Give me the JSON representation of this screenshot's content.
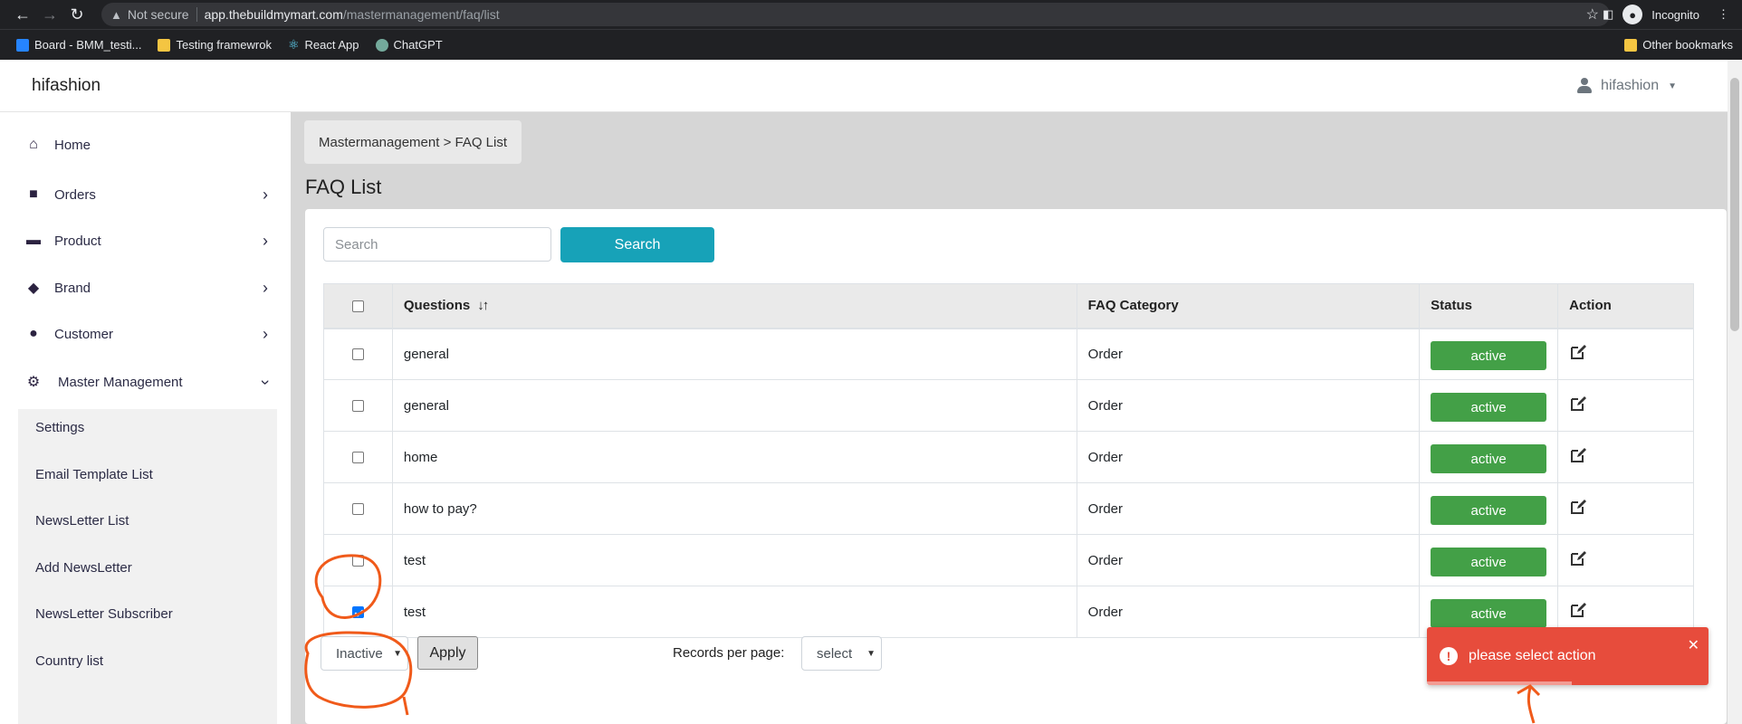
{
  "browser": {
    "security_label": "Not secure",
    "url_host": "app.thebuildmymart.com",
    "url_path": "/mastermanagement/faq/list",
    "profile_label": "Incognito",
    "bookmarks": [
      "Board - BMM_testi...",
      "Testing framewrok",
      "React App",
      "ChatGPT"
    ],
    "other_bookmarks": "Other bookmarks"
  },
  "header": {
    "brand": "hifashion",
    "user": "hifashion"
  },
  "sidebar": {
    "items": [
      {
        "label": "Home",
        "icon": "home-icon"
      },
      {
        "label": "Orders",
        "icon": "bag-icon"
      },
      {
        "label": "Product",
        "icon": "archive-icon"
      },
      {
        "label": "Brand",
        "icon": "tags-icon"
      },
      {
        "label": "Customer",
        "icon": "user-icon"
      },
      {
        "label": "Master Management",
        "icon": "user-gear-icon"
      }
    ],
    "submenu": [
      "Settings",
      "Email Template List",
      "NewsLetter List",
      "Add NewsLetter",
      "NewsLetter Subscriber",
      "Country list"
    ]
  },
  "main": {
    "breadcrumb": "Mastermanagement > FAQ List",
    "title": "FAQ List",
    "search_placeholder": "Search",
    "search_button": "Search",
    "columns": [
      "Questions",
      "FAQ Category",
      "Status",
      "Action"
    ],
    "rows": [
      {
        "question": "general",
        "category": "Order",
        "status": "active",
        "checked": false
      },
      {
        "question": "general",
        "category": "Order",
        "status": "active",
        "checked": false
      },
      {
        "question": "home",
        "category": "Order",
        "status": "active",
        "checked": false
      },
      {
        "question": "how to pay?",
        "category": "Order",
        "status": "active",
        "checked": false
      },
      {
        "question": "test",
        "category": "Order",
        "status": "active",
        "checked": false
      },
      {
        "question": "test",
        "category": "Order",
        "status": "active",
        "checked": true
      }
    ],
    "bulk_action_value": "Inactive",
    "apply_button": "Apply",
    "records_label": "Records per page:",
    "records_value": "select"
  },
  "toast": {
    "message": "please select action"
  },
  "colors": {
    "accent": "#17a2b8",
    "status_active": "#43a047",
    "toast": "#e74c3c",
    "annotation": "#f05a1a"
  }
}
